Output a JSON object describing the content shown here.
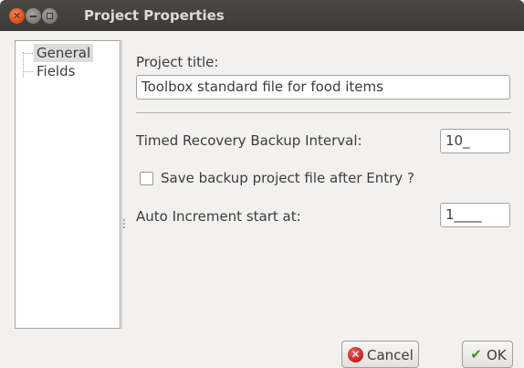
{
  "window": {
    "title": "Project Properties"
  },
  "tree": {
    "items": [
      "General",
      "Fields"
    ],
    "selected": "General"
  },
  "general": {
    "project_title_label": "Project title:",
    "project_title_value": "Toolbox standard file for food items",
    "backup_interval_label": "Timed Recovery Backup Interval:",
    "backup_interval_value": "10_",
    "save_backup_label": "Save backup project file after Entry ?",
    "save_backup_checked": false,
    "auto_increment_label": "Auto Increment start at:",
    "auto_increment_value": "1____"
  },
  "buttons": {
    "cancel": "Cancel",
    "ok": "OK"
  },
  "icons": {
    "cancel": "cancel-icon",
    "ok": "checkmark-icon"
  }
}
